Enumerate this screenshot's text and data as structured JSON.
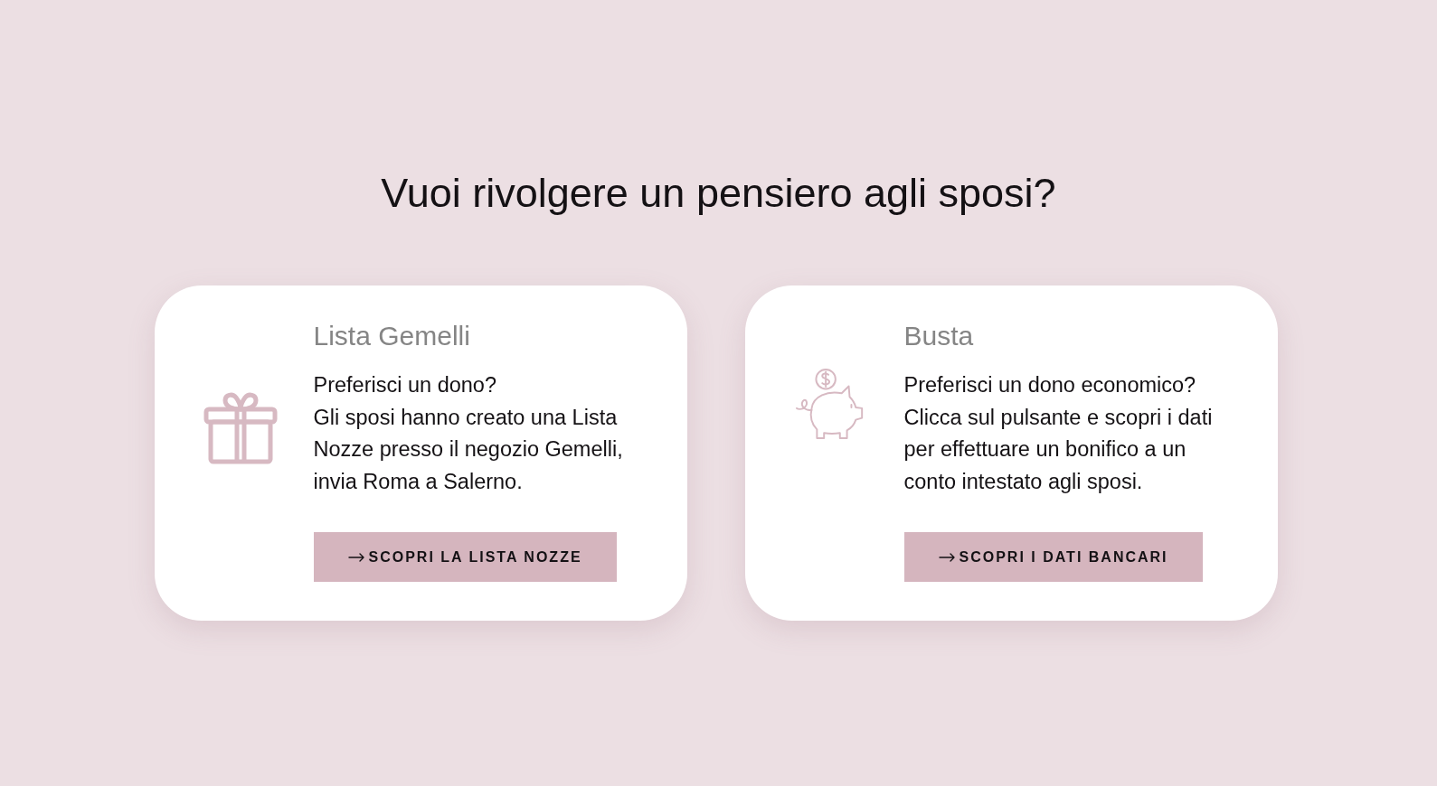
{
  "heading": "Vuoi rivolgere un pensiero agli sposi?",
  "cards": [
    {
      "kind": "gift",
      "title": "Lista Gemelli",
      "lines": [
        "Preferisci un dono?",
        "Gli sposi hanno creato una Lista",
        "Nozze presso il negozio Gemelli,",
        "invia Roma a Salerno."
      ],
      "button": "SCOPRI LA LISTA NOZZE"
    },
    {
      "kind": "piggy-bank",
      "title": "Busta",
      "lines": [
        "Preferisci un dono economico?",
        "Clicca sul pulsante e scopri i dati",
        "per effettuare un bonifico a un",
        "conto intestato agli sposi."
      ],
      "button": "SCOPRI I DATI BANCARI"
    }
  ]
}
